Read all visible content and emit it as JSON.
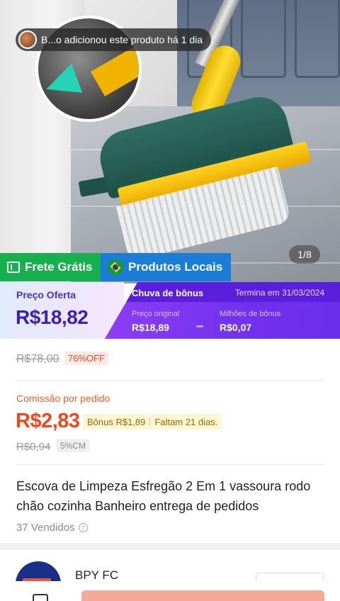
{
  "notification": {
    "text": "B...o adicionou este produto há 1 dia"
  },
  "gallery": {
    "indicator": "1/8"
  },
  "badges": {
    "frete": "Frete Grátis",
    "locais": "Produtos Locais"
  },
  "offer": {
    "label": "Preço Oferta",
    "price": "R$18,82",
    "bonus_title": "Chuva de bônus",
    "ends": "Termina em 31/03/2024",
    "original_label": "Preço original",
    "original_value": "R$18,89",
    "bonus_label": "Milhões de bônus",
    "bonus_value": "R$0,07"
  },
  "list_price": {
    "value": "R$78,00",
    "discount": "76%OFF"
  },
  "commission": {
    "label": "Comissão por pedido",
    "value": "R$2,83",
    "bonus": "Bônus R$1,89",
    "remaining": "Faltam 21 dias.",
    "old_value": "R$0,94",
    "rate": "5%CM"
  },
  "product": {
    "title": "Escova de Limpeza Esfregão 2 Em 1 vassoura rodo chão cozinha Banheiro entrega de pedidos",
    "sold": "37 Vendidos"
  },
  "shop": {
    "name": "BPY FC"
  },
  "colors": {
    "frete_green": "#16b04e",
    "locais_blue": "#1b7dd6",
    "offer_purple": "#7131ee",
    "commission_orange": "#f2461e"
  }
}
